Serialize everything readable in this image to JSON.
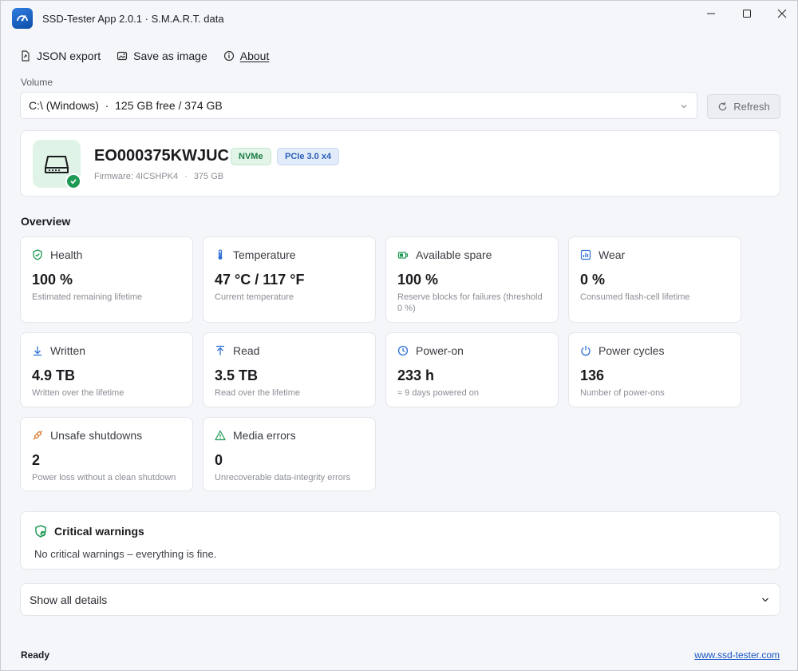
{
  "app": {
    "title": "SSD-Tester App 2.0.1 · S.M.A.R.T. data"
  },
  "toolbar": {
    "json_export": "JSON export",
    "save_image": "Save as image",
    "about": "About"
  },
  "volume": {
    "label": "Volume",
    "selected": "C:\\ (Windows)  ·  125 GB free / 374 GB",
    "refresh": "Refresh"
  },
  "drive": {
    "model": "EO000375KWJUC",
    "badges": [
      "NVMe",
      "PCIe 3.0 x4"
    ],
    "firmware": "Firmware: 4ICSHPK4",
    "size": "375 GB"
  },
  "overview": {
    "title": "Overview",
    "tiles": [
      {
        "label": "Health",
        "value": "100 %",
        "desc": "Estimated remaining lifetime",
        "icon": "shield-check-icon"
      },
      {
        "label": "Temperature",
        "value": "47 °C / 117 °F",
        "desc": "Current temperature",
        "icon": "thermometer-icon"
      },
      {
        "label": "Available spare",
        "value": "100 %",
        "desc": "Reserve blocks for failures (threshold 0 %)",
        "icon": "spare-icon"
      },
      {
        "label": "Wear",
        "value": "0 %",
        "desc": "Consumed flash-cell lifetime",
        "icon": "bar-chart-icon"
      },
      {
        "label": "Written",
        "value": "4.9 TB",
        "desc": "Written over the lifetime",
        "icon": "arrow-down-icon"
      },
      {
        "label": "Read",
        "value": "3.5 TB",
        "desc": "Read over the lifetime",
        "icon": "arrow-up-icon"
      },
      {
        "label": "Power-on",
        "value": "233 h",
        "desc": "≈ 9 days powered on",
        "icon": "clock-icon"
      },
      {
        "label": "Power cycles",
        "value": "136",
        "desc": "Number of power-ons",
        "icon": "power-icon"
      },
      {
        "label": "Unsafe shutdowns",
        "value": "2",
        "desc": "Power loss without a clean shutdown",
        "icon": "unplug-icon"
      },
      {
        "label": "Media errors",
        "value": "0",
        "desc": "Unrecoverable data-integrity errors",
        "icon": "warning-triangle-icon"
      }
    ]
  },
  "critical": {
    "title": "Critical warnings",
    "text": "No critical warnings – everything is fine."
  },
  "details": {
    "label": "Show all details"
  },
  "status": {
    "text": "Ready",
    "link": "www.ssd-tester.com"
  },
  "colors": {
    "accent_green": "#1f9a55",
    "accent_blue": "#2a5fb8",
    "link": "#1a56c4"
  }
}
